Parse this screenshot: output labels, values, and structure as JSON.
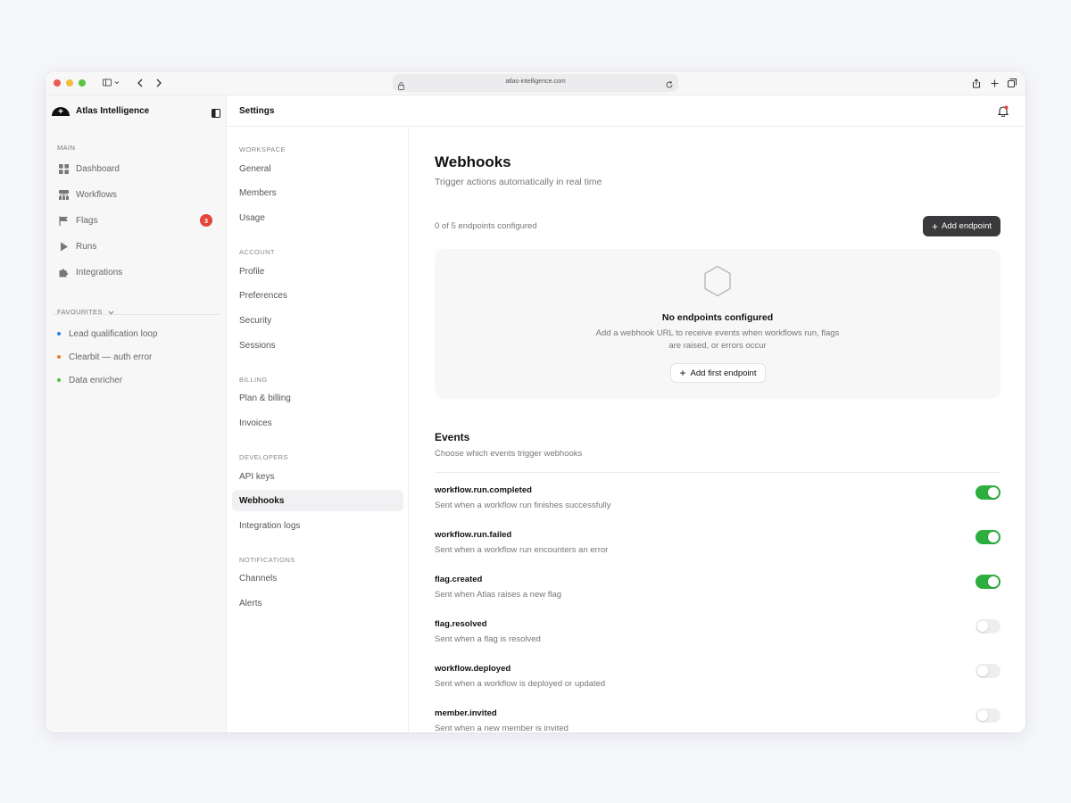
{
  "browser": {
    "url": "atlas-intelligence.com"
  },
  "app": {
    "name": "Atlas Intelligence"
  },
  "sidebar": {
    "main_label": "MAIN",
    "items": [
      {
        "label": "Dashboard",
        "icon": "grid-icon"
      },
      {
        "label": "Workflows",
        "icon": "hierarchy-icon"
      },
      {
        "label": "Flags",
        "icon": "flag-icon",
        "badge": "3"
      },
      {
        "label": "Runs",
        "icon": "play-icon"
      },
      {
        "label": "Integrations",
        "icon": "puzzle-icon"
      }
    ],
    "favourites_label": "FAVOURITES",
    "favourites": [
      {
        "label": "Lead qualification loop",
        "color": "#2d7cf6"
      },
      {
        "label": "Clearbit — auth error",
        "color": "#f07a22"
      },
      {
        "label": "Data enricher",
        "color": "#4fbf3d"
      }
    ]
  },
  "header": {
    "title": "Settings"
  },
  "settings_nav": {
    "sections": [
      {
        "label": "WORKSPACE",
        "items": [
          "General",
          "Members",
          "Usage"
        ]
      },
      {
        "label": "ACCOUNT",
        "items": [
          "Profile",
          "Preferences",
          "Security",
          "Sessions"
        ]
      },
      {
        "label": "BILLING",
        "items": [
          "Plan & billing",
          "Invoices"
        ]
      },
      {
        "label": "DEVELOPERS",
        "items": [
          "API keys",
          "Webhooks",
          "Integration logs"
        ]
      },
      {
        "label": "NOTIFICATIONS",
        "items": [
          "Channels",
          "Alerts"
        ]
      }
    ],
    "active": "Webhooks"
  },
  "main": {
    "title": "Webhooks",
    "subtitle": "Trigger actions automatically in real time",
    "count_text": "0 of 5 endpoints configured",
    "add_button": "Add endpoint",
    "empty": {
      "title": "No endpoints configured",
      "description": "Add a webhook URL to receive events when workflows run, flags are raised, or errors occur",
      "button": "Add first endpoint"
    },
    "events": {
      "title": "Events",
      "subtitle": "Choose which events trigger webhooks",
      "items": [
        {
          "name": "workflow.run.completed",
          "desc": "Sent when a workflow run finishes successfully",
          "enabled": true
        },
        {
          "name": "workflow.run.failed",
          "desc": "Sent when a workflow run encounters an error",
          "enabled": true
        },
        {
          "name": "flag.created",
          "desc": "Sent when Atlas raises a new flag",
          "enabled": true
        },
        {
          "name": "flag.resolved",
          "desc": "Sent when a flag is resolved",
          "enabled": false
        },
        {
          "name": "workflow.deployed",
          "desc": "Sent when a workflow is deployed or updated",
          "enabled": false
        },
        {
          "name": "member.invited",
          "desc": "Sent when a new member is invited",
          "enabled": false
        }
      ]
    }
  },
  "colors": {
    "accent_green": "#2eae3f",
    "badge_red": "#e5453a",
    "dark_button": "#3a3a3c"
  }
}
